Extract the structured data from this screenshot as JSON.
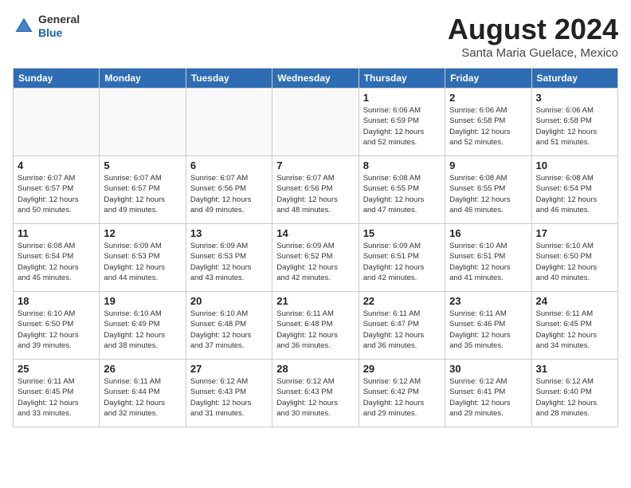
{
  "header": {
    "logo_general": "General",
    "logo_blue": "Blue",
    "month_title": "August 2024",
    "subtitle": "Santa Maria Guelace, Mexico"
  },
  "calendar": {
    "days_of_week": [
      "Sunday",
      "Monday",
      "Tuesday",
      "Wednesday",
      "Thursday",
      "Friday",
      "Saturday"
    ],
    "weeks": [
      [
        {
          "day": "",
          "info": ""
        },
        {
          "day": "",
          "info": ""
        },
        {
          "day": "",
          "info": ""
        },
        {
          "day": "",
          "info": ""
        },
        {
          "day": "1",
          "info": "Sunrise: 6:06 AM\nSunset: 6:59 PM\nDaylight: 12 hours\nand 52 minutes."
        },
        {
          "day": "2",
          "info": "Sunrise: 6:06 AM\nSunset: 6:58 PM\nDaylight: 12 hours\nand 52 minutes."
        },
        {
          "day": "3",
          "info": "Sunrise: 6:06 AM\nSunset: 6:58 PM\nDaylight: 12 hours\nand 51 minutes."
        }
      ],
      [
        {
          "day": "4",
          "info": "Sunrise: 6:07 AM\nSunset: 6:57 PM\nDaylight: 12 hours\nand 50 minutes."
        },
        {
          "day": "5",
          "info": "Sunrise: 6:07 AM\nSunset: 6:57 PM\nDaylight: 12 hours\nand 49 minutes."
        },
        {
          "day": "6",
          "info": "Sunrise: 6:07 AM\nSunset: 6:56 PM\nDaylight: 12 hours\nand 49 minutes."
        },
        {
          "day": "7",
          "info": "Sunrise: 6:07 AM\nSunset: 6:56 PM\nDaylight: 12 hours\nand 48 minutes."
        },
        {
          "day": "8",
          "info": "Sunrise: 6:08 AM\nSunset: 6:55 PM\nDaylight: 12 hours\nand 47 minutes."
        },
        {
          "day": "9",
          "info": "Sunrise: 6:08 AM\nSunset: 6:55 PM\nDaylight: 12 hours\nand 46 minutes."
        },
        {
          "day": "10",
          "info": "Sunrise: 6:08 AM\nSunset: 6:54 PM\nDaylight: 12 hours\nand 46 minutes."
        }
      ],
      [
        {
          "day": "11",
          "info": "Sunrise: 6:08 AM\nSunset: 6:54 PM\nDaylight: 12 hours\nand 45 minutes."
        },
        {
          "day": "12",
          "info": "Sunrise: 6:09 AM\nSunset: 6:53 PM\nDaylight: 12 hours\nand 44 minutes."
        },
        {
          "day": "13",
          "info": "Sunrise: 6:09 AM\nSunset: 6:53 PM\nDaylight: 12 hours\nand 43 minutes."
        },
        {
          "day": "14",
          "info": "Sunrise: 6:09 AM\nSunset: 6:52 PM\nDaylight: 12 hours\nand 42 minutes."
        },
        {
          "day": "15",
          "info": "Sunrise: 6:09 AM\nSunset: 6:51 PM\nDaylight: 12 hours\nand 42 minutes."
        },
        {
          "day": "16",
          "info": "Sunrise: 6:10 AM\nSunset: 6:51 PM\nDaylight: 12 hours\nand 41 minutes."
        },
        {
          "day": "17",
          "info": "Sunrise: 6:10 AM\nSunset: 6:50 PM\nDaylight: 12 hours\nand 40 minutes."
        }
      ],
      [
        {
          "day": "18",
          "info": "Sunrise: 6:10 AM\nSunset: 6:50 PM\nDaylight: 12 hours\nand 39 minutes."
        },
        {
          "day": "19",
          "info": "Sunrise: 6:10 AM\nSunset: 6:49 PM\nDaylight: 12 hours\nand 38 minutes."
        },
        {
          "day": "20",
          "info": "Sunrise: 6:10 AM\nSunset: 6:48 PM\nDaylight: 12 hours\nand 37 minutes."
        },
        {
          "day": "21",
          "info": "Sunrise: 6:11 AM\nSunset: 6:48 PM\nDaylight: 12 hours\nand 36 minutes."
        },
        {
          "day": "22",
          "info": "Sunrise: 6:11 AM\nSunset: 6:47 PM\nDaylight: 12 hours\nand 36 minutes."
        },
        {
          "day": "23",
          "info": "Sunrise: 6:11 AM\nSunset: 6:46 PM\nDaylight: 12 hours\nand 35 minutes."
        },
        {
          "day": "24",
          "info": "Sunrise: 6:11 AM\nSunset: 6:45 PM\nDaylight: 12 hours\nand 34 minutes."
        }
      ],
      [
        {
          "day": "25",
          "info": "Sunrise: 6:11 AM\nSunset: 6:45 PM\nDaylight: 12 hours\nand 33 minutes."
        },
        {
          "day": "26",
          "info": "Sunrise: 6:11 AM\nSunset: 6:44 PM\nDaylight: 12 hours\nand 32 minutes."
        },
        {
          "day": "27",
          "info": "Sunrise: 6:12 AM\nSunset: 6:43 PM\nDaylight: 12 hours\nand 31 minutes."
        },
        {
          "day": "28",
          "info": "Sunrise: 6:12 AM\nSunset: 6:43 PM\nDaylight: 12 hours\nand 30 minutes."
        },
        {
          "day": "29",
          "info": "Sunrise: 6:12 AM\nSunset: 6:42 PM\nDaylight: 12 hours\nand 29 minutes."
        },
        {
          "day": "30",
          "info": "Sunrise: 6:12 AM\nSunset: 6:41 PM\nDaylight: 12 hours\nand 29 minutes."
        },
        {
          "day": "31",
          "info": "Sunrise: 6:12 AM\nSunset: 6:40 PM\nDaylight: 12 hours\nand 28 minutes."
        }
      ]
    ]
  }
}
